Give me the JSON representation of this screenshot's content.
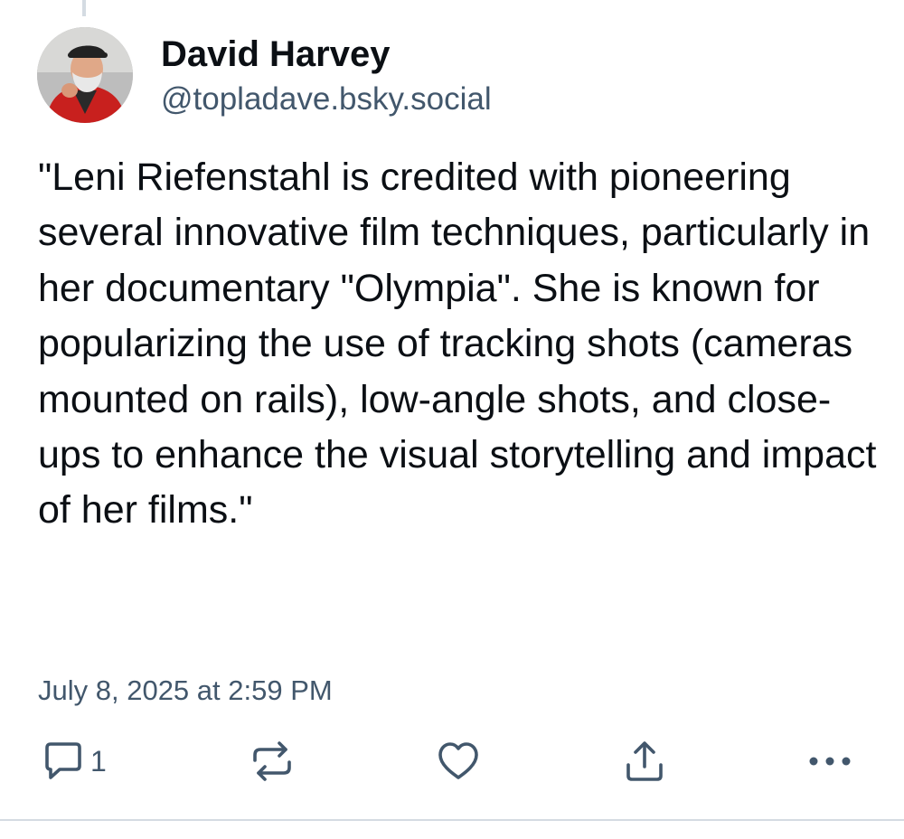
{
  "post": {
    "author": {
      "display_name": "David Harvey",
      "handle": "@topladave.bsky.social"
    },
    "text": "\"Leni Riefenstahl is credited with pioneering several innovative film techniques, particularly in her documentary \"Olympia\". She is known for popularizing the use of tracking shots (cameras mounted on rails), low-angle shots, and close-ups to enhance the visual storytelling and impact of her films.\"",
    "timestamp": "July 8, 2025 at 2:59 PM",
    "actions": {
      "reply": {
        "icon": "reply-icon",
        "count": "1"
      },
      "repost": {
        "icon": "repost-icon"
      },
      "like": {
        "icon": "heart-icon"
      },
      "share": {
        "icon": "share-icon"
      },
      "more": {
        "icon": "more-icon"
      }
    }
  },
  "colors": {
    "text_primary": "#0b0f14",
    "text_secondary": "#42576c",
    "divider": "#d4dbe2"
  }
}
